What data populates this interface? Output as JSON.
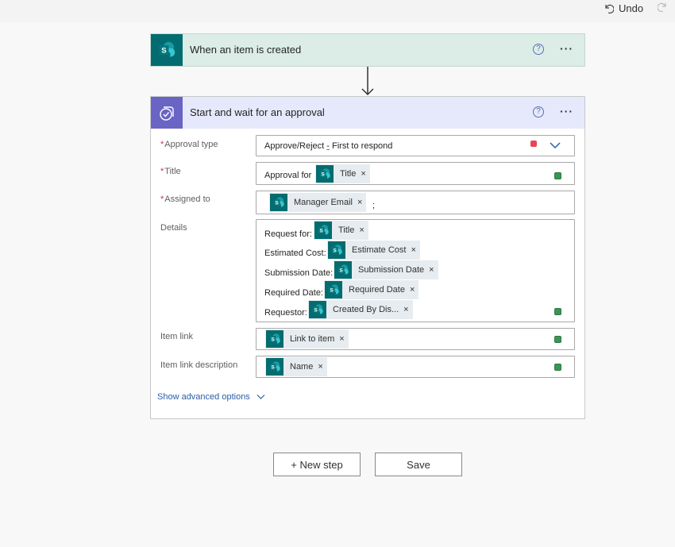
{
  "toolbar": {
    "undo_label": "Undo"
  },
  "trigger": {
    "title": "When an item is created",
    "help": "?",
    "more": "···"
  },
  "approval": {
    "title": "Start and wait for an approval",
    "help": "?",
    "more": "···",
    "fields": {
      "approval_type": {
        "label": "Approval type",
        "required": "*",
        "value_pre": "Approve/Reject ",
        "value_dash": "-",
        "value_post": " First to respond"
      },
      "title": {
        "label": "Title",
        "required": "*",
        "prefix": "Approval for",
        "token": "Title"
      },
      "assigned_to": {
        "label": "Assigned to",
        "required": "*",
        "token": "Manager Email",
        "suffix": ";"
      },
      "details": {
        "label": "Details",
        "lines": [
          {
            "prefix": "Request for:",
            "token": "Title"
          },
          {
            "prefix": "Estimated Cost:",
            "token": "Estimate Cost"
          },
          {
            "prefix": "Submission Date:",
            "token": "Submission Date"
          },
          {
            "prefix": "Required Date:",
            "token": "Required Date"
          },
          {
            "prefix": "Requestor:",
            "token": "Created By Dis..."
          }
        ]
      },
      "item_link": {
        "label": "Item link",
        "token": "Link to item"
      },
      "item_link_description": {
        "label": "Item link description",
        "token": "Name"
      }
    },
    "advanced_label": "Show advanced options"
  },
  "token_remove": "×",
  "buttons": {
    "new_step": "+ New step",
    "save": "Save"
  },
  "colors": {
    "sharepoint": "#036c70",
    "approvals": "#6a64c4",
    "link": "#2a5ea8",
    "trigger_bg": "#dbede6",
    "approval_bg": "#e6e9fb"
  }
}
